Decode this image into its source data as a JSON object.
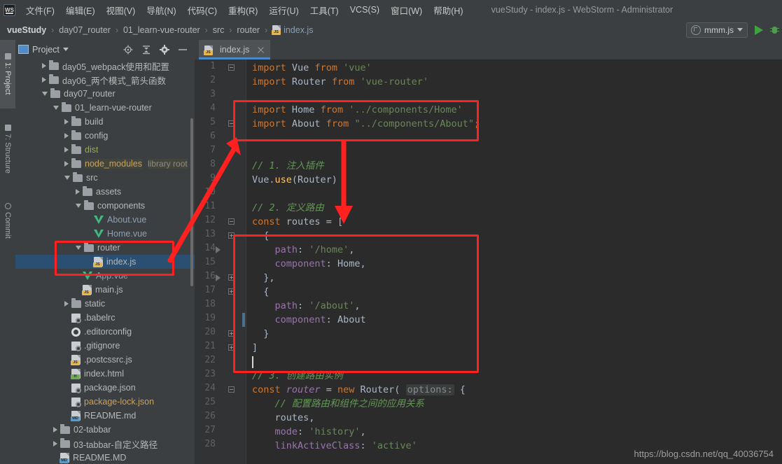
{
  "window": {
    "title": "vueStudy - index.js - WebStorm - Administrator",
    "logo": "WS"
  },
  "menubar": {
    "items": [
      {
        "label": "文件(F)",
        "name": "menu-file"
      },
      {
        "label": "编辑(E)",
        "name": "menu-edit"
      },
      {
        "label": "视图(V)",
        "name": "menu-view"
      },
      {
        "label": "导航(N)",
        "name": "menu-navigate"
      },
      {
        "label": "代码(C)",
        "name": "menu-code"
      },
      {
        "label": "重构(R)",
        "name": "menu-refactor"
      },
      {
        "label": "运行(U)",
        "name": "menu-run"
      },
      {
        "label": "工具(T)",
        "name": "menu-tools"
      },
      {
        "label": "VCS(S)",
        "name": "menu-vcs"
      },
      {
        "label": "窗口(W)",
        "name": "menu-window"
      },
      {
        "label": "帮助(H)",
        "name": "menu-help"
      }
    ]
  },
  "breadcrumb": {
    "items": [
      "vueStudy",
      "day07_router",
      "01_learn-vue-router",
      "src",
      "router",
      "index.js"
    ],
    "separator": "›"
  },
  "run_config": {
    "name": "mmm.js",
    "run_icon": "play-icon",
    "debug_icon": "debug-icon",
    "dropdown_icon": "chevron-down-icon"
  },
  "tool_strip": {
    "buttons": [
      {
        "label": "1: Project",
        "icon": "project-icon",
        "active": true
      },
      {
        "label": "7: Structure",
        "icon": "structure-icon",
        "active": false
      },
      {
        "label": "Commit",
        "icon": "commit-icon",
        "active": false
      }
    ]
  },
  "project_panel": {
    "title": "Project",
    "header_icons": [
      "locate-icon",
      "collapse-all-icon",
      "gear-icon",
      "hide-icon"
    ],
    "tree": [
      {
        "label": "day05_webpack使用和配置",
        "indent": 1,
        "type": "folder",
        "state": "collapsed"
      },
      {
        "label": "day06_两个模式_箭头函数",
        "indent": 1,
        "type": "folder",
        "state": "collapsed"
      },
      {
        "label": "day07_router",
        "indent": 1,
        "type": "folder",
        "state": "expanded"
      },
      {
        "label": "01_learn-vue-router",
        "indent": 2,
        "type": "folder",
        "state": "expanded"
      },
      {
        "label": "build",
        "indent": 3,
        "type": "folder",
        "state": "collapsed"
      },
      {
        "label": "config",
        "indent": 3,
        "type": "folder",
        "state": "collapsed"
      },
      {
        "label": "dist",
        "indent": 3,
        "type": "folder",
        "state": "collapsed",
        "color": "dist"
      },
      {
        "label": "node_modules",
        "indent": 3,
        "type": "folder",
        "state": "collapsed",
        "color": "nodemod",
        "suffix": "library root"
      },
      {
        "label": "src",
        "indent": 3,
        "type": "folder",
        "state": "expanded"
      },
      {
        "label": "assets",
        "indent": 4,
        "type": "folder",
        "state": "collapsed"
      },
      {
        "label": "components",
        "indent": 4,
        "type": "folder",
        "state": "expanded"
      },
      {
        "label": "About.vue",
        "indent": 5,
        "type": "vue"
      },
      {
        "label": "Home.vue",
        "indent": 5,
        "type": "vue"
      },
      {
        "label": "router",
        "indent": 4,
        "type": "folder",
        "state": "expanded"
      },
      {
        "label": "index.js",
        "indent": 5,
        "type": "js",
        "selected": true
      },
      {
        "label": "App.vue",
        "indent": 4,
        "type": "vue"
      },
      {
        "label": "main.js",
        "indent": 4,
        "type": "js"
      },
      {
        "label": "static",
        "indent": 3,
        "type": "folder",
        "state": "collapsed"
      },
      {
        "label": ".babelrc",
        "indent": 3,
        "type": "config"
      },
      {
        "label": ".editorconfig",
        "indent": 3,
        "type": "gear"
      },
      {
        "label": ".gitignore",
        "indent": 3,
        "type": "config"
      },
      {
        "label": ".postcssrc.js",
        "indent": 3,
        "type": "js"
      },
      {
        "label": "index.html",
        "indent": 3,
        "type": "html"
      },
      {
        "label": "package.json",
        "indent": 3,
        "type": "config"
      },
      {
        "label": "package-lock.json",
        "indent": 3,
        "type": "config",
        "color": "lock"
      },
      {
        "label": "README.md",
        "indent": 3,
        "type": "md"
      },
      {
        "label": "02-tabbar",
        "indent": 2,
        "type": "folder",
        "state": "collapsed"
      },
      {
        "label": "03-tabbar-自定义路径",
        "indent": 2,
        "type": "folder",
        "state": "collapsed"
      },
      {
        "label": "README.MD",
        "indent": 2,
        "type": "md"
      }
    ]
  },
  "editor": {
    "tab": {
      "label": "index.js",
      "icon": "js-file-icon",
      "close_icon": "close-icon"
    },
    "caret_line": 22,
    "lines": [
      {
        "n": 1,
        "fold": "minus",
        "html": "<span class=\"k\">import</span> <span class=\"id\">Vue</span> <span class=\"k\">from</span> <span class=\"s\">'vue'</span>"
      },
      {
        "n": 2,
        "html": "<span class=\"k\">import</span> <span class=\"id\">Router</span> <span class=\"k\">from</span> <span class=\"s\">'vue-router'</span>"
      },
      {
        "n": 3,
        "html": ""
      },
      {
        "n": 4,
        "html": "<span class=\"k\">import</span> <span class=\"id\">Home</span> <span class=\"k\">from</span> <span class=\"s\">'../components/Home'</span>"
      },
      {
        "n": 5,
        "fold": "minus",
        "html": "<span class=\"k\">import</span> <span class=\"id\">About</span> <span class=\"k\">from</span> <span class=\"s\">\"../components/About\"</span><span class=\"k\">;</span>"
      },
      {
        "n": 6,
        "html": ""
      },
      {
        "n": 7,
        "html": ""
      },
      {
        "n": 8,
        "html": "<span class=\"c\">// 1. 注入插件</span>"
      },
      {
        "n": 9,
        "html": "<span class=\"id\">Vue.</span><span class=\"f\">use</span><span class=\"id\">(Router)</span>"
      },
      {
        "n": 10,
        "html": ""
      },
      {
        "n": 11,
        "html": "<span class=\"c\">// 2. 定义路由</span>"
      },
      {
        "n": 12,
        "fold": "minus",
        "html": "<span class=\"k\">const</span> <span class=\"id\">routes</span> <span class=\"id\">=</span> <span class=\"id\">[</span>"
      },
      {
        "n": 13,
        "fold": "plus",
        "html": "  <span class=\"id\">{</span>"
      },
      {
        "n": 14,
        "run": true,
        "html": "    <span class=\"p\">path</span><span class=\"id\">:</span> <span class=\"s\">'/home'</span><span class=\"id\">,</span>"
      },
      {
        "n": 15,
        "html": "    <span class=\"p\">component</span><span class=\"id\">:</span> <span class=\"id\">Home,</span>"
      },
      {
        "n": 16,
        "fold": "plus",
        "run": true,
        "html": "  <span class=\"id\">},</span>"
      },
      {
        "n": 17,
        "fold": "plus",
        "html": "  <span class=\"id\">{</span>"
      },
      {
        "n": 18,
        "html": "    <span class=\"p\">path</span><span class=\"id\">:</span> <span class=\"s\">'/about'</span><span class=\"id\">,</span>"
      },
      {
        "n": 19,
        "change": true,
        "html": "    <span class=\"p\">component</span><span class=\"id\">:</span> <span class=\"id\">About</span>"
      },
      {
        "n": 20,
        "fold": "plus",
        "html": "  <span class=\"id\">}</span>"
      },
      {
        "n": 21,
        "fold": "plus",
        "html": "<span class=\"id\">]</span>"
      },
      {
        "n": 22,
        "html": ""
      },
      {
        "n": 23,
        "html": "<span class=\"c\">// 3. 创建路由实例</span>"
      },
      {
        "n": 24,
        "fold": "minus",
        "html": "<span class=\"k\">const</span> <span class=\"ital\">router</span> <span class=\"id\">=</span> <span class=\"k\">new</span> <span class=\"id\">Router(</span> <span class=\"hintp\">options:</span> <span class=\"id\">{</span>"
      },
      {
        "n": 25,
        "html": "    <span class=\"c\">// 配置路由和组件之间的应用关系</span>"
      },
      {
        "n": 26,
        "html": "    <span class=\"id\">routes,</span>"
      },
      {
        "n": 27,
        "html": "    <span class=\"p\">mode</span><span class=\"id\">:</span> <span class=\"s\">'history'</span><span class=\"id\">,</span>"
      },
      {
        "n": 28,
        "html": "    <span class=\"p\">linkActiveClass</span><span class=\"id\">:</span> <span class=\"s\">'active'</span>"
      }
    ]
  },
  "annotations": {
    "boxes": [
      "import-statements-highlight",
      "routes-array-highlight",
      "router-folder-highlight"
    ],
    "arrows": [
      "arrow-tree-to-imports",
      "arrow-imports-to-routes"
    ],
    "color": "#ff2020"
  },
  "watermark": {
    "text": "https://blog.csdn.net/qq_40036754"
  }
}
